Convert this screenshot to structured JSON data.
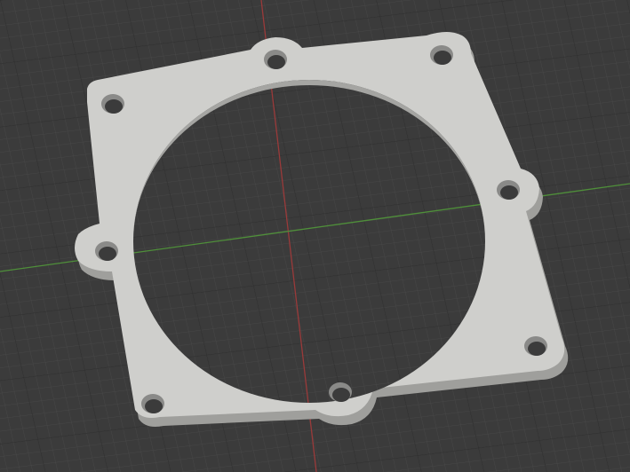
{
  "viewport": {
    "background_color": "#3b3b3b",
    "grid_minor_color": "#444444",
    "grid_major_color": "#2f2f2f",
    "x_axis_color": "#9a3a3a",
    "y_axis_color": "#4f8f3a"
  },
  "model": {
    "name": "flange-gasket-plate",
    "top_color": "#cfcfcc",
    "side_color": "#9f9f9c",
    "hole_color": "#8a8a88",
    "mounting_hole_count": 8
  }
}
